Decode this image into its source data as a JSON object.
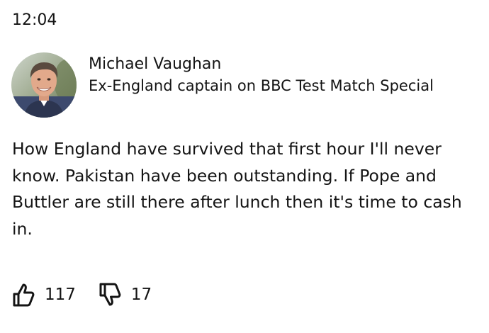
{
  "post": {
    "time": "12:04",
    "author": {
      "name": "Michael Vaughan",
      "role": "Ex-England captain on BBC Test Match Special",
      "avatar_icon": "person-photo"
    },
    "text": "How England have survived that first hour I'll never know. Pakistan have been outstanding. If Pope and Buttler are still there after lunch then it's time to cash in.",
    "reactions": {
      "like": {
        "icon": "thumbs-up-icon",
        "count": "117"
      },
      "dislike": {
        "icon": "thumbs-down-icon",
        "count": "17"
      }
    }
  }
}
